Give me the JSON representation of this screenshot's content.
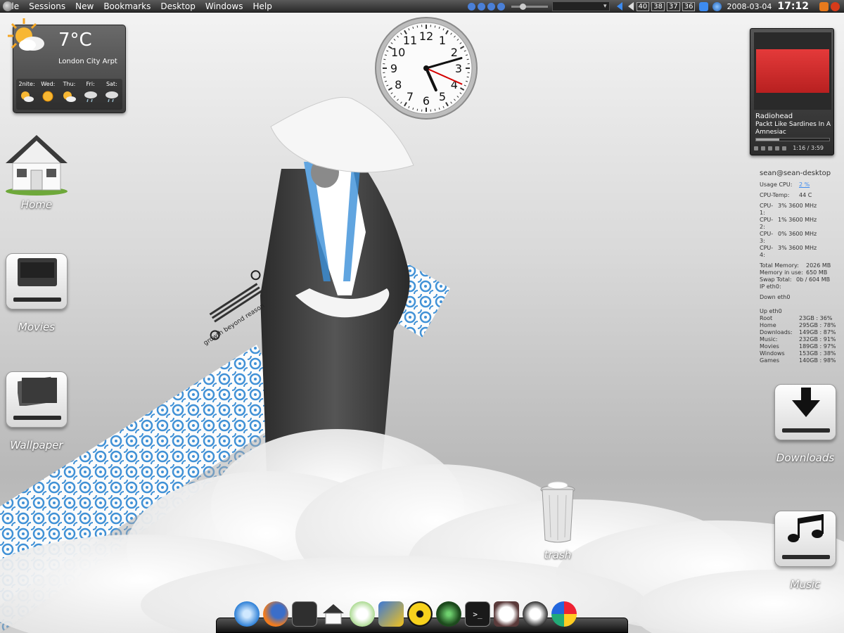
{
  "menubar": {
    "items": [
      "File",
      "Sessions",
      "New",
      "Bookmarks",
      "Desktop",
      "Windows",
      "Help"
    ],
    "desktops": [
      "40",
      "38",
      "37",
      "36"
    ],
    "date": "2008-03-04",
    "time": "17:12"
  },
  "weather": {
    "temperature": "7°C",
    "location": "London City Arpt",
    "forecast": [
      {
        "day": "2nite:",
        "icon": "partly-cloudy-icon"
      },
      {
        "day": "Wed:",
        "icon": "sunny-icon"
      },
      {
        "day": "Thu:",
        "icon": "partly-cloudy-icon"
      },
      {
        "day": "Fri:",
        "icon": "rain-cloud-icon"
      },
      {
        "day": "Sat:",
        "icon": "rain-cloud-icon"
      }
    ]
  },
  "clock": {
    "numbers": [
      "12",
      "1",
      "2",
      "3",
      "4",
      "5",
      "6",
      "7",
      "8",
      "9",
      "10",
      "11"
    ],
    "hour": 5,
    "minute": 12,
    "second": 19
  },
  "player": {
    "artist": "Radiohead",
    "track": "Packt Like Sardines In A Crushd Tin Box",
    "album": "Amnesiac",
    "time": "1:16 / 3:59",
    "progress": 0.32
  },
  "sysmon": {
    "host": "sean@sean-desktop",
    "usage_cpu_label": "Usage CPU:",
    "usage_cpu": "2 %",
    "cpu_temp_label": "CPU-Temp:",
    "cpu_temp": "44 C",
    "cpus": [
      {
        "label": "CPU-1:",
        "value": "3%   3600 MHz"
      },
      {
        "label": "CPU-2:",
        "value": "1%   3600 MHz"
      },
      {
        "label": "CPU-3:",
        "value": "0%   3600 MHz"
      },
      {
        "label": "CPU-4:",
        "value": "3%   3600 MHz"
      }
    ],
    "memory": [
      {
        "label": "Total Memory:",
        "value": "2026 MB"
      },
      {
        "label": "Memory in use:",
        "value": "650 MB"
      },
      {
        "label": "Swap Total:",
        "value": "0b / 604 MB"
      },
      {
        "label": "IP eth0:",
        "value": ""
      }
    ],
    "down_label": "Down eth0",
    "up_label": "Up eth0",
    "disks": [
      {
        "label": "Root",
        "value": "23GB : 36%"
      },
      {
        "label": "Home",
        "value": "295GB : 78%"
      },
      {
        "label": "Downloads:",
        "value": "149GB : 87%"
      },
      {
        "label": "Music:",
        "value": "232GB : 91%"
      },
      {
        "label": "Movies",
        "value": "189GB : 97%"
      },
      {
        "label": "Windows",
        "value": "153GB : 38%"
      },
      {
        "label": "Games",
        "value": "140GB : 98%"
      }
    ]
  },
  "desktop_icons": {
    "home": "Home",
    "movies": "Movies",
    "wallpaper": "Wallpaper",
    "downloads": "Downloads",
    "music": "Music",
    "trash": "trash"
  },
  "wallpaper_text": "growth beyond reason",
  "dock": [
    "safari-compass-icon",
    "firefox-icon",
    "film-icon",
    "home-icon",
    "itunes-icon",
    "media-player-icon",
    "radiation-icon",
    "network-globe-icon",
    "terminal-icon",
    "stopwatch-icon",
    "update-icon",
    "color-wheel-icon"
  ],
  "colors": {
    "accent_blue": "#3d8bf0",
    "pattern_blue": "#3a8fd8",
    "album_red": "#e03434",
    "clock_second_hand": "#d40000"
  }
}
